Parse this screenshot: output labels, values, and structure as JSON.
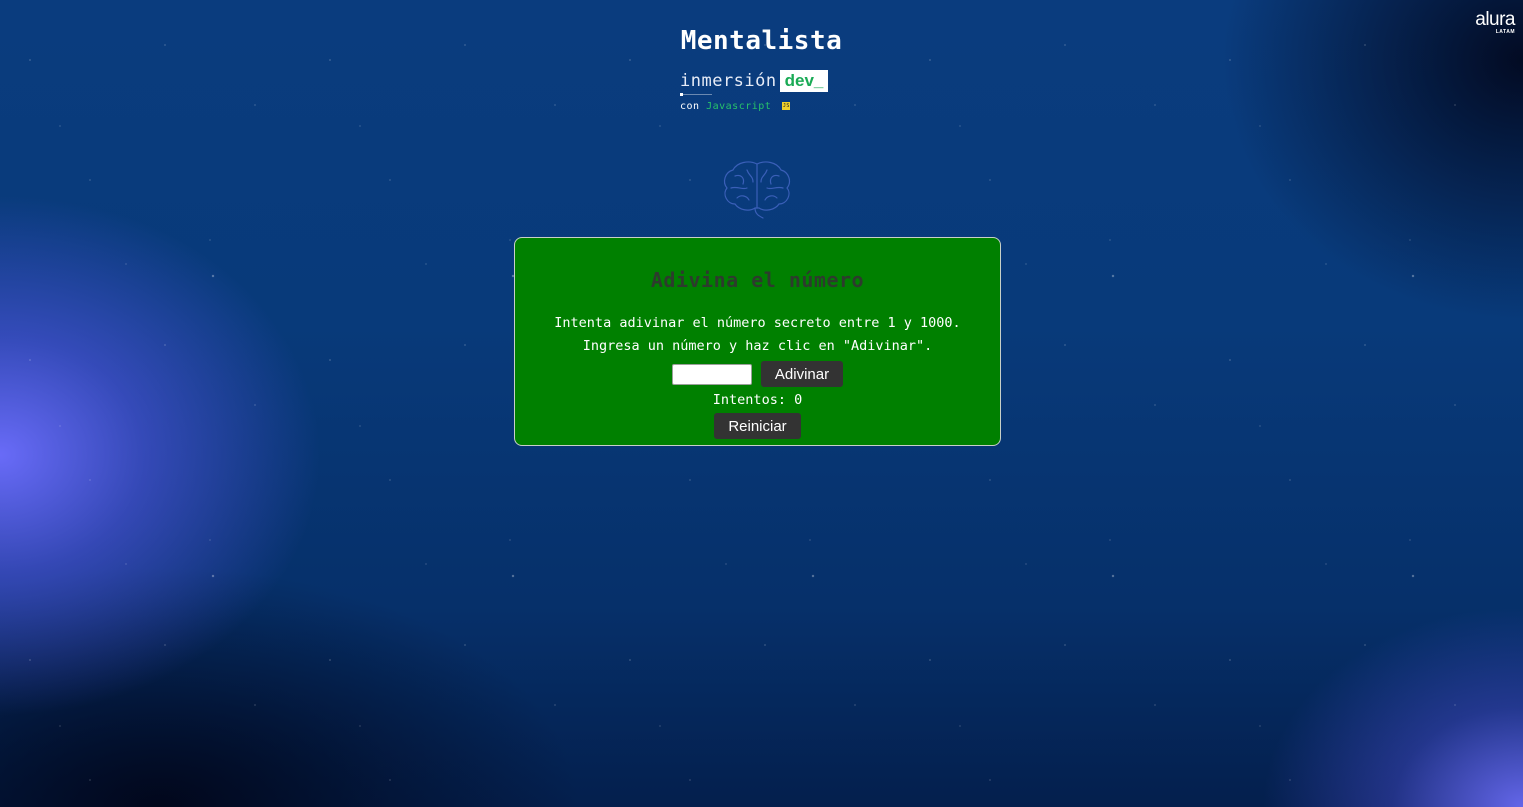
{
  "branding": {
    "logo_main": "alura",
    "logo_sub": "LATAM"
  },
  "header": {
    "title": "Mentalista",
    "event_name": "inmersión",
    "event_tag": "dev_",
    "sub_prefix": "con",
    "sub_language": "Javascript",
    "language_icon": "js-icon",
    "illustration_icon": "brain-icon"
  },
  "game": {
    "title": "Adivina el número",
    "instruction_line1": "Intenta adivinar el número secreto entre 1 y 1000.",
    "instruction_line2": "Ingresa un número y haz clic en \"Adivinar\".",
    "guess_input_value": "",
    "guess_button_label": "Adivinar",
    "attempts_text": "Intentos: 0",
    "reset_button_label": "Reiniciar"
  },
  "colors": {
    "card_background": "#008000",
    "card_title": "#2d3b2d",
    "button_background": "#333333",
    "tag_text": "#1aaa55",
    "language_text": "#27c26a",
    "page_background": "#083a7a"
  }
}
